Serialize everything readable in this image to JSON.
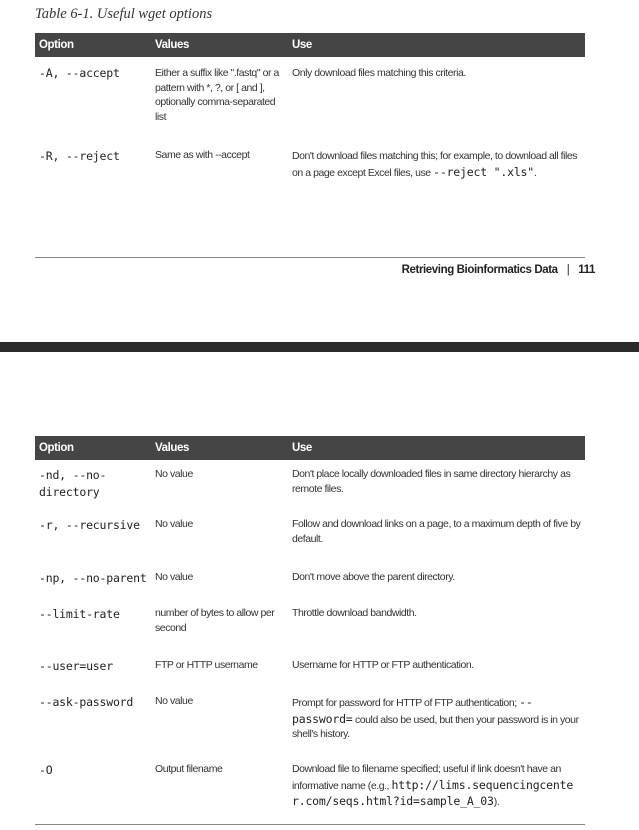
{
  "page1": {
    "caption": "Table 6-1. Useful wget options",
    "headers": [
      "Option",
      "Values",
      "Use"
    ],
    "rows": [
      {
        "option": "-A, --accept",
        "values": "Either a suffix like \".fastq\" or a pattern with *, ?, or [ and ], optionally comma-separated list",
        "use": "Only download files matching this criteria."
      },
      {
        "option": "-R, --reject",
        "values": "Same as with --accept",
        "use_pre": "Don't download files matching this; for example, to download all files on a page except Excel files, use ",
        "use_code": "--reject \".xls\"",
        "use_post": "."
      }
    ],
    "footer_title": "Retrieving Bioinformatics Data",
    "footer_sep": "|",
    "page_number": "111"
  },
  "page2": {
    "headers": [
      "Option",
      "Values",
      "Use"
    ],
    "rows": [
      {
        "option": "-nd, --no-directory",
        "values": "No value",
        "use": "Don't place locally downloaded files in same directory hierarchy as remote files."
      },
      {
        "option": "-r, --recursive",
        "values": "No value",
        "use": "Follow and download links on a page, to a maximum depth of five by default."
      },
      {
        "option": "-np, --no-parent",
        "values": "No value",
        "use": "Don't move above the parent directory."
      },
      {
        "option": "--limit-rate",
        "values": "number of bytes to allow per second",
        "use": "Throttle download bandwidth."
      },
      {
        "option": "--user=user",
        "values": "FTP or HTTP username",
        "use": "Username for HTTP or FTP authentication."
      },
      {
        "option": "--ask-password",
        "values": "No value",
        "use_pre": "Prompt for password for HTTP of FTP authentication; ",
        "use_code": "--password=",
        "use_post": " could also be used, but then your password is in your shell's history."
      },
      {
        "option": "-O",
        "values": "Output filename",
        "use_pre": "Download file to filename specified; useful if link doesn't have an informative name (e.g., ",
        "use_code": "http://lims.sequencingcenter.com/seqs.html?id=sample_A_03",
        "use_post": ")."
      }
    ]
  }
}
